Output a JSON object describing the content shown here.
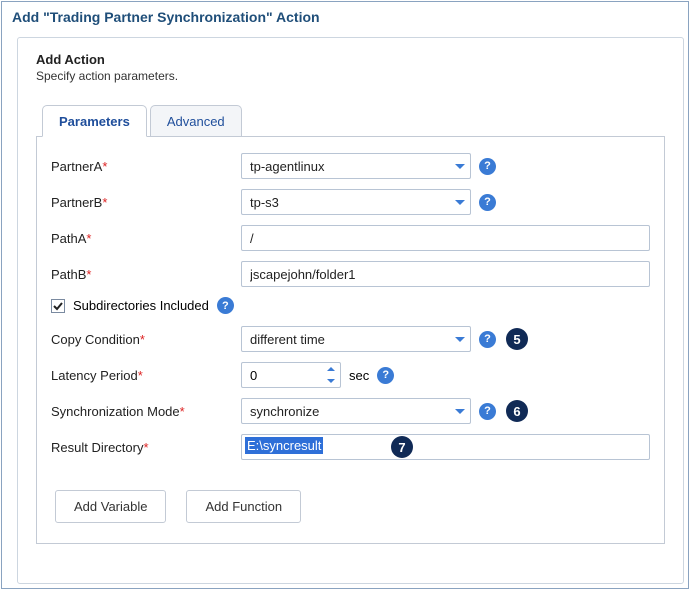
{
  "dialog": {
    "title": "Add \"Trading Partner Synchronization\" Action"
  },
  "header": {
    "title": "Add Action",
    "subtitle": "Specify action parameters."
  },
  "tabs": {
    "parameters": "Parameters",
    "advanced": "Advanced"
  },
  "fields": {
    "partnerA": {
      "label": "PartnerA",
      "value": "tp-agentlinux"
    },
    "partnerB": {
      "label": "PartnerB",
      "value": "tp-s3"
    },
    "pathA": {
      "label": "PathA",
      "value": "/"
    },
    "pathB": {
      "label": "PathB",
      "value": "jscapejohn/folder1"
    },
    "subdirs": {
      "label": "Subdirectories Included",
      "checked": true
    },
    "copyCond": {
      "label": "Copy Condition",
      "value": "different time"
    },
    "latency": {
      "label": "Latency Period",
      "value": "0",
      "unit": "sec"
    },
    "syncMode": {
      "label": "Synchronization Mode",
      "value": "synchronize"
    },
    "resultDir": {
      "label": "Result Directory",
      "value": "E:\\syncresult"
    }
  },
  "callouts": {
    "copyCond": "5",
    "syncMode": "6",
    "resultDir": "7"
  },
  "buttons": {
    "addVariable": "Add Variable",
    "addFunction": "Add Function"
  },
  "markers": {
    "required": "*",
    "help": "?"
  }
}
